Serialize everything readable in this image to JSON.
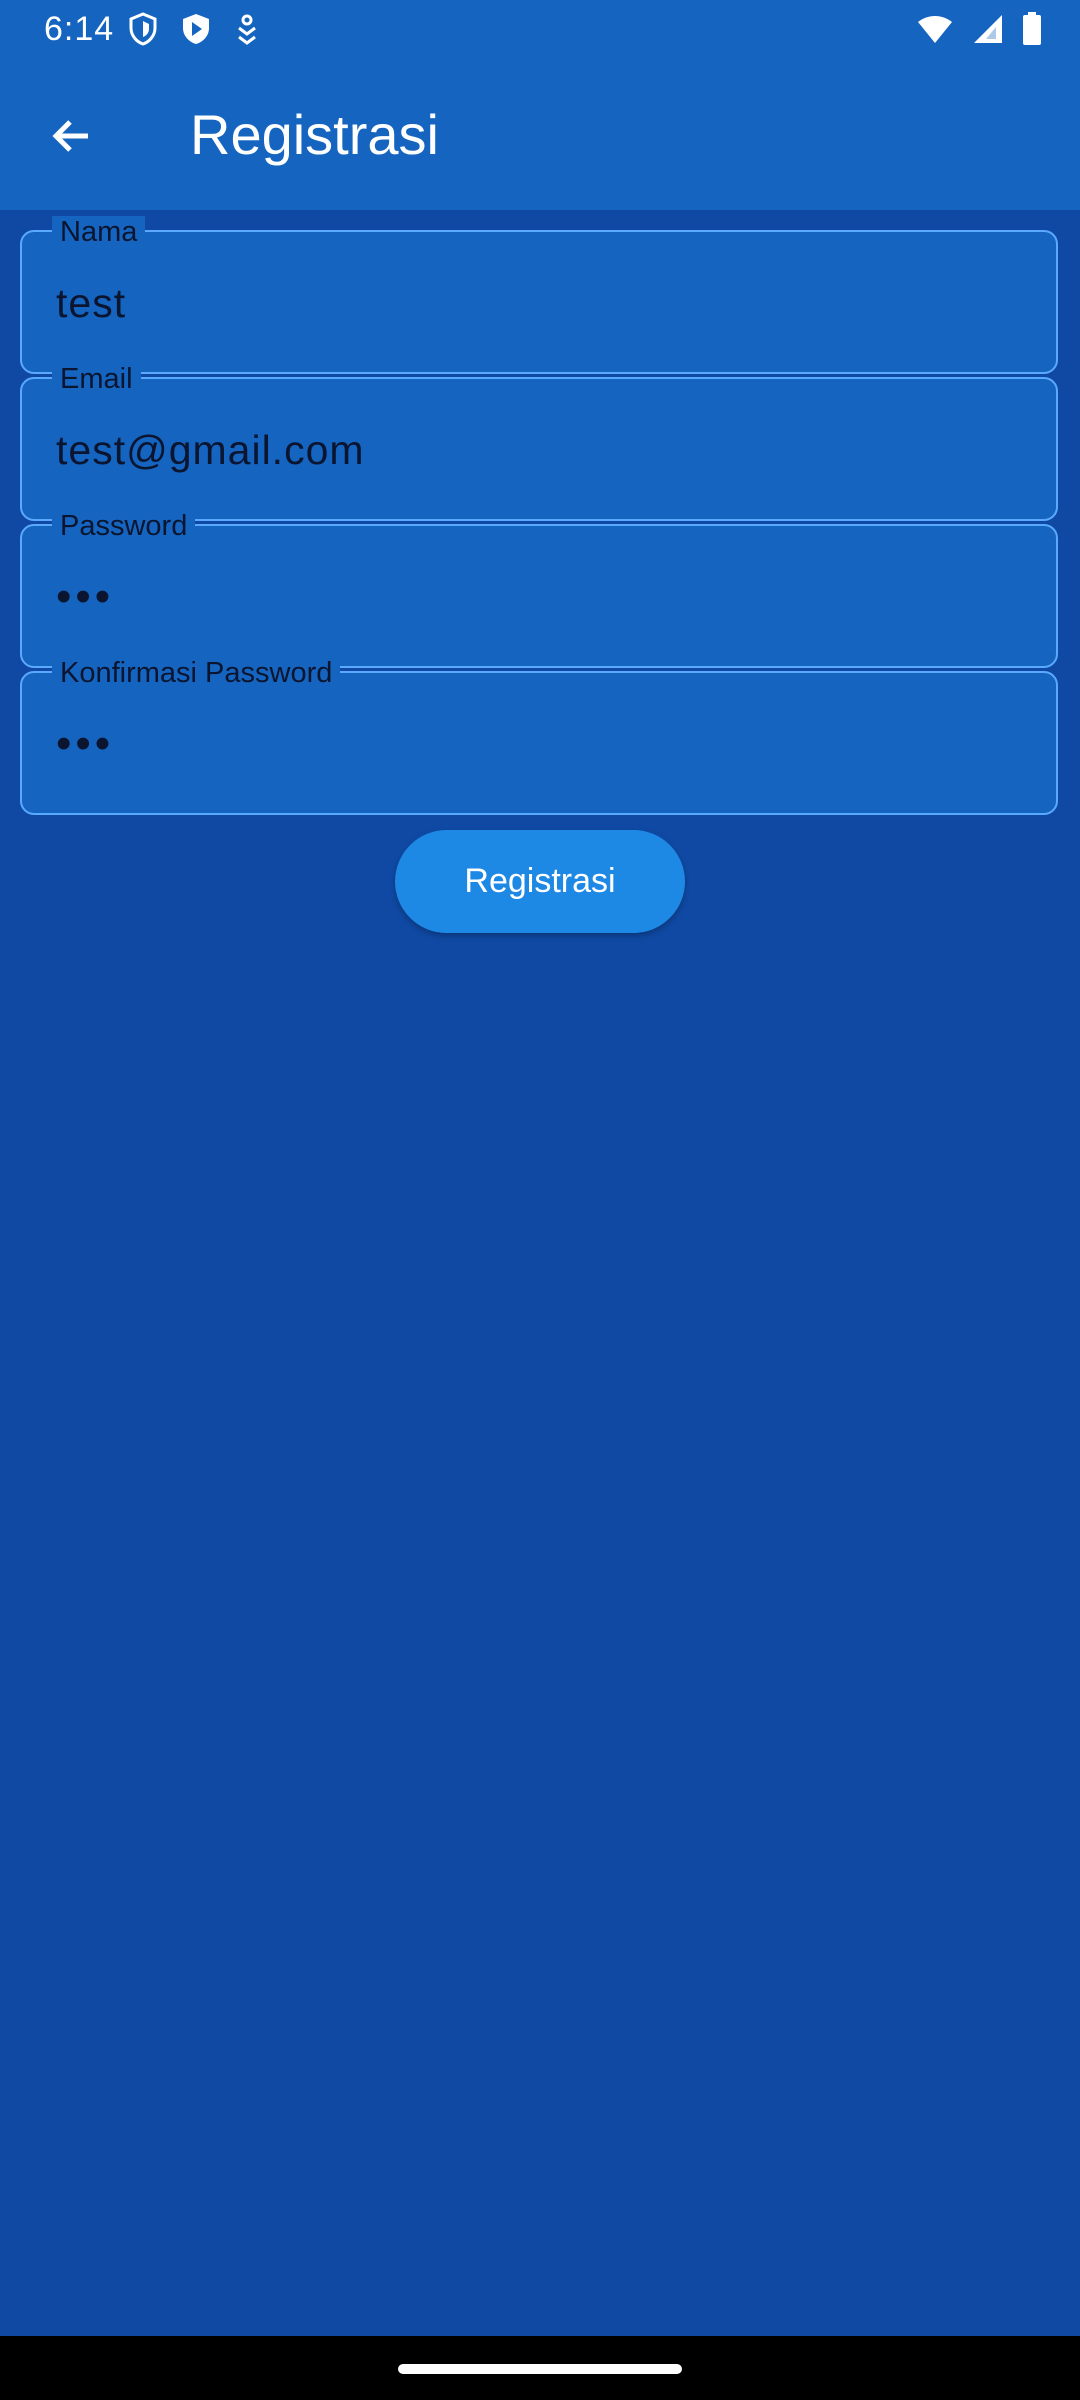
{
  "status_bar": {
    "time": "6:14",
    "icons_left": [
      "shield-icon",
      "play-shield-icon",
      "download-icon"
    ],
    "icons_right": [
      "wifi-icon",
      "signal-icon",
      "battery-icon"
    ]
  },
  "app_bar": {
    "title": "Registrasi",
    "back_icon": "arrow-back-icon"
  },
  "form": {
    "fields": [
      {
        "label": "Nama",
        "value": "test"
      },
      {
        "label": "Email",
        "value": "test@gmail.com"
      },
      {
        "label": "Password",
        "value": "•••"
      },
      {
        "label": "Konfirmasi Password",
        "value": "•••"
      }
    ],
    "submit_label": "Registrasi"
  },
  "colors": {
    "background": "#0f49a3",
    "app_bar": "#1565c0",
    "field_border": "#5aa9ff",
    "button": "#1e88e5"
  }
}
